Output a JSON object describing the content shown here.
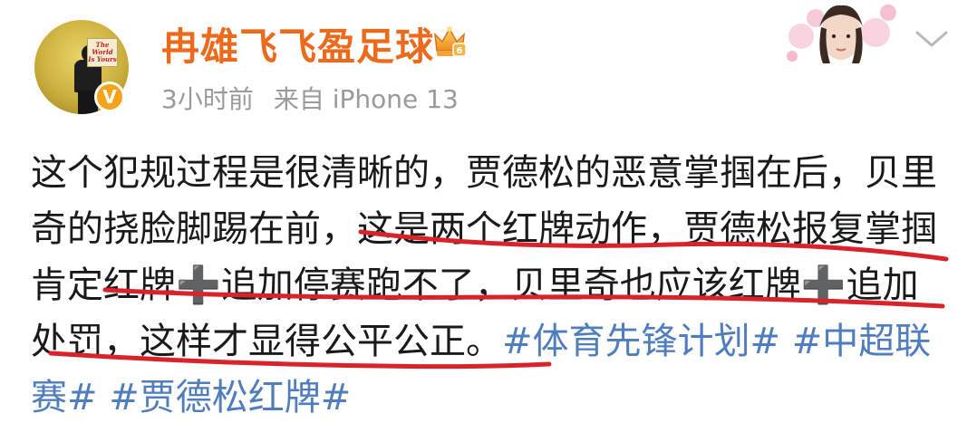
{
  "user": {
    "name": "冉雄飞飞盈足球",
    "avatar_sign_text": "The World Is Yours",
    "verify_badge": "V"
  },
  "meta": {
    "time": "3小时前",
    "source": "来自 iPhone 13"
  },
  "icons": {
    "crown": "crown-badge-icon",
    "verify": "verified-badge-icon",
    "menu": "chevron-down-icon",
    "decoration": "profile-decoration-icon"
  },
  "colors": {
    "username": "#ec6a1c",
    "meta": "#9a9a9a",
    "text": "#1a1a1a",
    "hashtag": "#4f7dbd",
    "underline": "#d8232a",
    "verify": "#f6a21b"
  },
  "post": {
    "line1": "这个犯规过程是很清晰的，贾德松的恶意掌掴在后，贝里",
    "line2": "奇的挠脸脚踢在前，这是两个红牌动作，贾德松报复掌掴",
    "line3_a": "肯定红牌",
    "line3_cross": "➕",
    "line3_b": "追加停赛跑不了，贝里奇也应该红牌",
    "line3_cross2": "➕",
    "line3_c": "追加",
    "line4_a": "处罚，这样才显得公平公正。",
    "tag1": "#体育先锋计划#",
    "tag2": "#中超联",
    "tag2_cont": "赛#",
    "tag3": "#贾德松红牌#"
  }
}
